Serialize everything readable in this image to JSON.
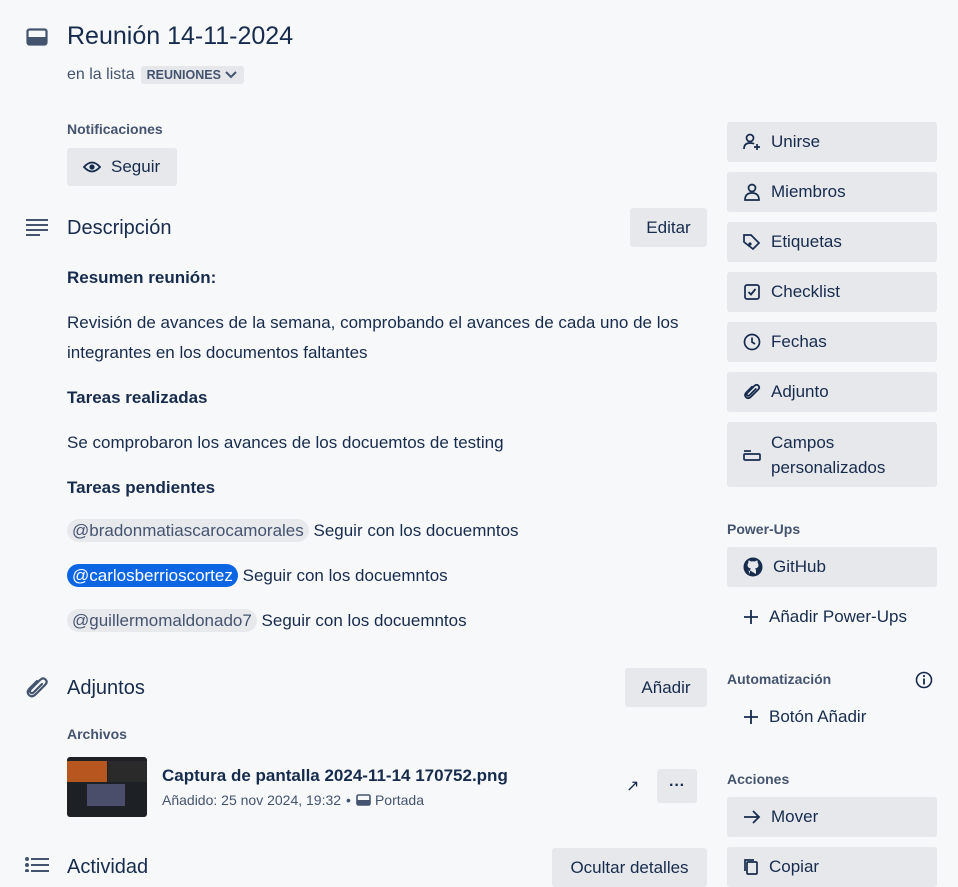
{
  "card": {
    "title": "Reunión 14-11-2024",
    "in_list_prefix": "en la lista",
    "list_name": "REUNIONES"
  },
  "notifications": {
    "label": "Notificaciones",
    "follow_label": "Seguir"
  },
  "description": {
    "heading": "Descripción",
    "edit_label": "Editar",
    "summary_heading": "Resumen reunión:",
    "summary_line1": "Revisión de avances de la semana, comprobando el avances de cada uno de los",
    "summary_line2": "integrantes en los documentos faltantes",
    "done_heading": "Tareas realizadas",
    "done_text": "Se comprobaron los avances de los docuemtos de testing",
    "pending_heading": "Tareas pendientes",
    "pending": [
      {
        "mention": "@bradonmatiascarocamorales",
        "text": "Seguir con los docuemntos"
      },
      {
        "mention": "@carlosberrioscortez",
        "text": "Seguir con los docuemntos"
      },
      {
        "mention": "@guillermomaldonado7",
        "text": "Seguir con los docuemntos"
      }
    ]
  },
  "attachments": {
    "heading": "Adjuntos",
    "add_label": "Añadir",
    "files_label": "Archivos",
    "file_name": "Captura de pantalla 2024-11-14 170752.png",
    "file_added": "Añadido: 25 nov 2024, 19:32",
    "file_separator": "•",
    "cover_label": "Portada",
    "more_label": "···",
    "open_arrow": "↗"
  },
  "activity": {
    "heading": "Actividad",
    "hide_details_label": "Ocultar detalles"
  },
  "sidebar": {
    "items": [
      {
        "label": "Unirse",
        "icon": "join-icon"
      },
      {
        "label": "Miembros",
        "icon": "person-icon"
      },
      {
        "label": "Etiquetas",
        "icon": "tag-icon"
      },
      {
        "label": "Checklist",
        "icon": "checklist-icon"
      },
      {
        "label": "Fechas",
        "icon": "clock-icon"
      },
      {
        "label": "Adjunto",
        "icon": "paperclip-icon"
      },
      {
        "label_line1": "Campos",
        "label_line2": "personalizados",
        "icon": "custom-fields-icon"
      }
    ],
    "powerups_label": "Power-Ups",
    "github_label": "GitHub",
    "add_powerups_label": "Añadir Power-Ups",
    "automation_label": "Automatización",
    "add_button_label": "Botón Añadir",
    "actions_label": "Acciones",
    "move_label": "Mover",
    "copy_label": "Copiar"
  },
  "colors": {
    "text": "#172b4d",
    "subtle": "#44546f",
    "button_bg": "#e6e8eb",
    "mention_me": "#0c66e4"
  }
}
